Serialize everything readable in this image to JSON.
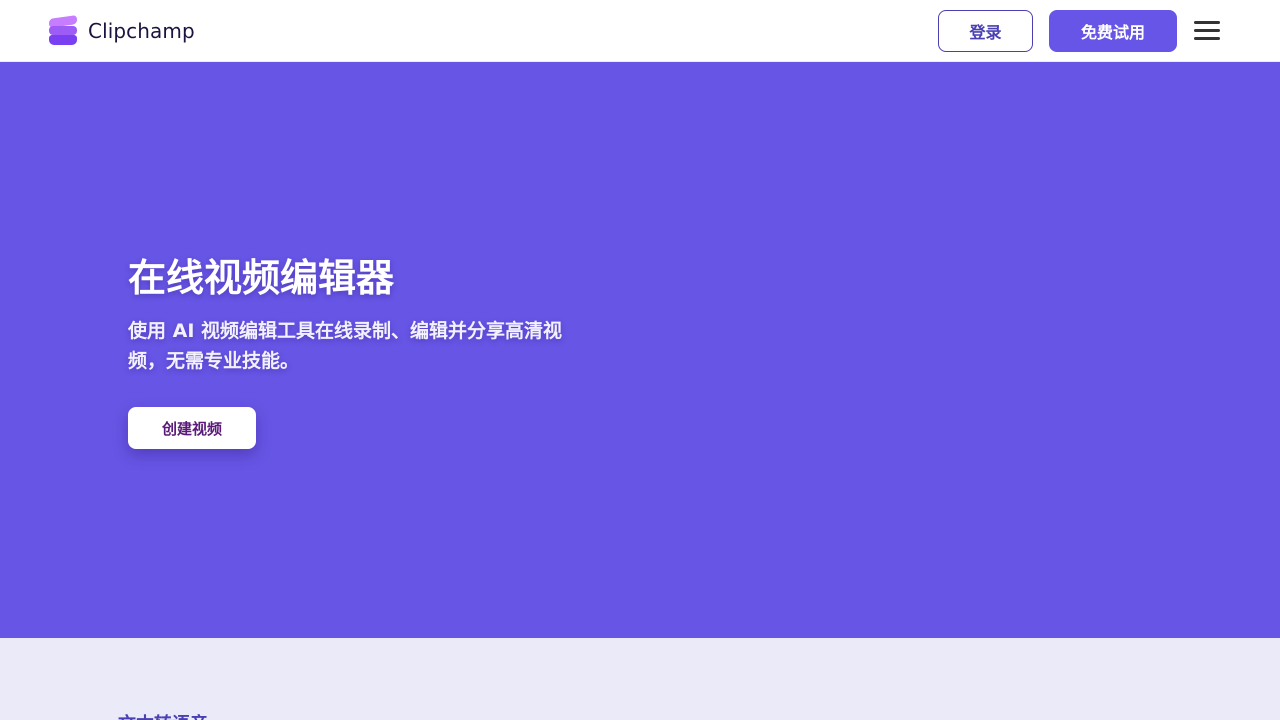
{
  "header": {
    "brand_name": "Clipchamp",
    "logo_icon": "clipchamp-logo-icon",
    "login_label": "登录",
    "trial_label": "免费试用",
    "menu_icon": "hamburger-menu-icon"
  },
  "hero": {
    "title": "在线视频编辑器",
    "subtitle": "使用 AI 视频编辑工具在线录制、编辑并分享高清视频，无需专业技能。",
    "cta_label": "创建视频",
    "background_color": "#6755e5"
  },
  "next_section": {
    "heading": "文本转语音",
    "background_color": "#ebeaf9"
  },
  "colors": {
    "accent": "#6655e6",
    "login_border": "#4a3fb3",
    "cta_text": "#5a1a7a"
  }
}
